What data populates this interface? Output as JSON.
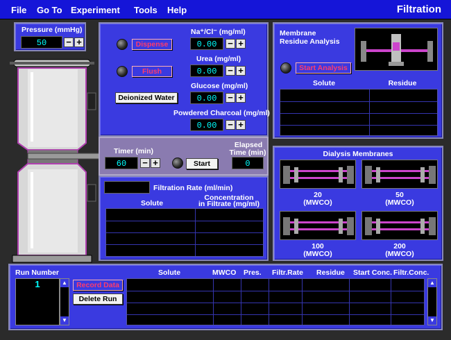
{
  "menu": {
    "items": [
      "File",
      "Go To",
      "Experiment",
      "Tools",
      "Help"
    ],
    "title": "Filtration"
  },
  "pressure": {
    "label": "Pressure (mmHg)",
    "value": "50"
  },
  "solutions": {
    "nacl": {
      "label": "Na⁺/Cl⁻ (mg/ml)",
      "value": "0.00"
    },
    "urea": {
      "label": "Urea (mg/ml)",
      "value": "0.00"
    },
    "glucose": {
      "label": "Glucose (mg/ml)",
      "value": "0.00"
    },
    "charcoal": {
      "label": "Powdered Charcoal (mg/ml)",
      "value": "0.00"
    },
    "dispense_label": "Dispense",
    "flush_label": "Flush",
    "deionized_label": "Deionized Water"
  },
  "membrane_analysis": {
    "title_line1": "Membrane",
    "title_line2": "Residue Analysis",
    "start_label": "Start Analysis",
    "col_solute": "Solute",
    "col_residue": "Residue"
  },
  "timer": {
    "label": "Timer (min)",
    "value": "60",
    "start_label": "Start",
    "elapsed_line1": "Elapsed",
    "elapsed_line2": "Time (min)",
    "elapsed_value": "0"
  },
  "filtration": {
    "rate_label": "Filtration Rate (ml/min)",
    "rate_value": "",
    "col_solute": "Solute",
    "col_conc_line1": "Concentration",
    "col_conc_line2": "in Filtrate (mg/ml)"
  },
  "dialysis": {
    "title": "Dialysis Membranes",
    "membranes": [
      {
        "value": "20",
        "unit": "(MWCO)"
      },
      {
        "value": "50",
        "unit": "(MWCO)"
      },
      {
        "value": "100",
        "unit": "(MWCO)"
      },
      {
        "value": "200",
        "unit": "(MWCO)"
      }
    ]
  },
  "runs": {
    "label": "Run Number",
    "current": "1",
    "record_label": "Record Data",
    "delete_label": "Delete Run",
    "columns": [
      "Solute",
      "MWCO",
      "Pres.",
      "Filtr.Rate",
      "Residue",
      "Start Conc.",
      "Filtr.Conc."
    ]
  },
  "colors": {
    "accent": "#3a3ae0",
    "menubar": "#1515d8",
    "lcd_text": "#00ffff",
    "alert_red": "#ff3b6b",
    "timer_panel": "#8a7bb0"
  }
}
